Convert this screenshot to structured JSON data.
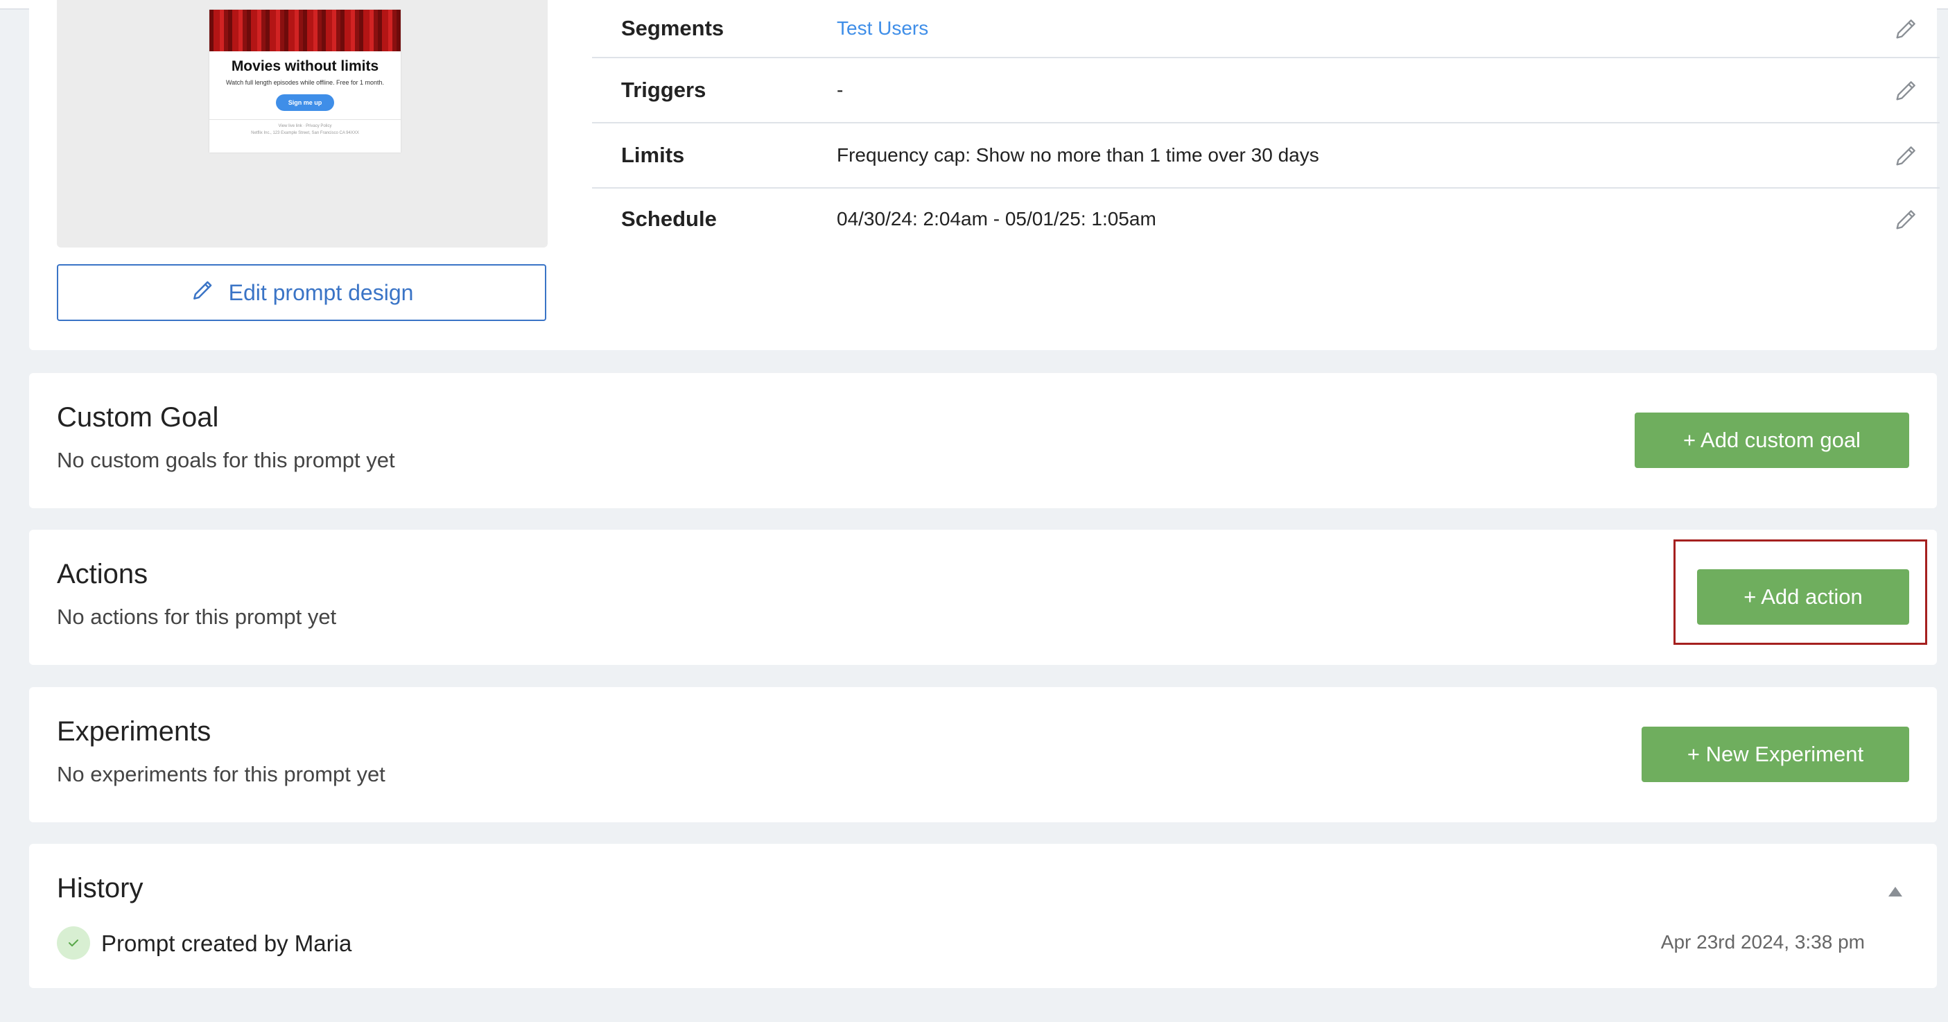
{
  "preview": {
    "title": "Movies without limits",
    "subtitle": "Watch full length episodes while offline. Free for 1 month.",
    "cta": "Sign me up",
    "footer_line1": "View live link  ·  Privacy Policy",
    "footer_line2": "Netflix Inc., 123 Example Street, San Francisco CA 94XXX"
  },
  "edit_button": "Edit prompt design",
  "details": [
    {
      "label": "Segments",
      "value": "Test Users"
    },
    {
      "label": "Triggers",
      "value": "-"
    },
    {
      "label": "Limits",
      "value": "Frequency cap: Show no more than 1 time over 30 days"
    },
    {
      "label": "Schedule",
      "value": "04/30/24: 2:04am - 05/01/25: 1:05am"
    }
  ],
  "custom_goal": {
    "title": "Custom Goal",
    "empty": "No custom goals for this prompt yet",
    "button": "+ Add custom goal"
  },
  "actions": {
    "title": "Actions",
    "empty": "No actions for this prompt yet",
    "button": "+ Add action"
  },
  "experiments": {
    "title": "Experiments",
    "empty": "No experiments for this prompt yet",
    "button": "+ New Experiment"
  },
  "history": {
    "title": "History",
    "entries": [
      {
        "text": "Prompt created by Maria",
        "time": "Apr 23rd 2024, 3:38 pm"
      }
    ]
  },
  "colors": {
    "accent_green": "#6fae5e",
    "link_blue": "#3f8ee8",
    "highlight_red": "#a5201f"
  }
}
